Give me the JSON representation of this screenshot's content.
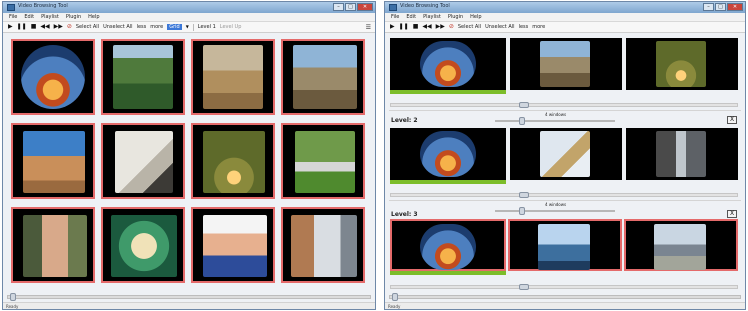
{
  "window_left": {
    "title": "Video Browsing Tool",
    "menu": [
      "File",
      "Edit",
      "Playlist",
      "Plugin",
      "Help"
    ],
    "toolbar": {
      "select_all": "Select All",
      "unselect_all": "Unselect All",
      "less": "less",
      "more": "more",
      "mode": "Grid",
      "level": "Level 1",
      "level_up": "Level Up"
    },
    "status": "Ready"
  },
  "window_right": {
    "title": "Video Browsing Tool",
    "menu": [
      "File",
      "Edit",
      "Playlist",
      "Plugin",
      "Help"
    ],
    "toolbar": {
      "select_all": "Select All",
      "unselect_all": "Unselect All",
      "less": "less",
      "more": "more"
    },
    "level2": {
      "label": "Level: 2",
      "windows": "4 windows",
      "close": "X"
    },
    "level3": {
      "label": "Level: 3",
      "windows": "4 windows",
      "close": "X"
    },
    "status": "Ready"
  },
  "colors": {
    "selected_border": "#e46a6a",
    "progress_green": "#7cbd2a",
    "titlebar": "#9dbde0"
  }
}
